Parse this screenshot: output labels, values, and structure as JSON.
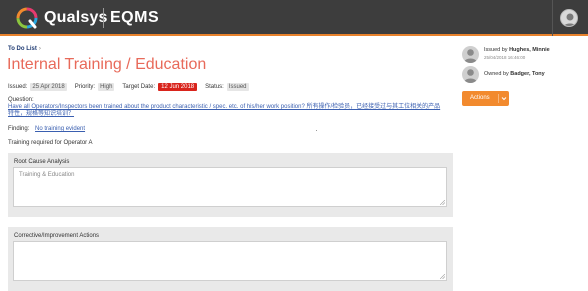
{
  "header": {
    "brand": "Qualsys",
    "product": "EQMS",
    "colors": {
      "bar": "#3d3d3d",
      "accent": "#e8822c"
    }
  },
  "breadcrumb": {
    "label": "To Do List",
    "arrow": "›"
  },
  "page": {
    "title": "Internal Training / Education"
  },
  "meta": {
    "issued_label": "Issued:",
    "issued_value": "25 Apr 2018",
    "priority_label": "Priority:",
    "priority_value": "High",
    "target_label": "Target Date:",
    "target_value": "12 Jun 2018",
    "status_label": "Status:",
    "status_value": "Issued",
    "target_color": "#d9241c"
  },
  "question": {
    "label": "Question:",
    "text": "Have all Operators/Inspectors been trained about the product characteristic / spec. etc. of his/her work position? 所有操作/检验员，已经接受过与其工位相关的产品特性，规格等知识培训？"
  },
  "finding": {
    "label": "Finding:",
    "value": "No training evident"
  },
  "training_note": "Training required for Operator A",
  "root_cause": {
    "label": "Root Cause Analysis",
    "placeholder": "Training & Education"
  },
  "corrective": {
    "label": "Corrective/Improvement Actions",
    "placeholder": ""
  },
  "issued_by": {
    "prefix": "Issued by",
    "name": "Hughes, Minnie",
    "date": "25/04/2018 16:46:00"
  },
  "owned_by": {
    "prefix": "Owned by",
    "name": "Badger, Tony"
  },
  "actions": {
    "label": "Actions",
    "color": "#f28a2e"
  },
  "icons": [
    "qualsys-logo-icon",
    "user-avatar-icon",
    "chevron-down-icon",
    "resize-grip-icon"
  ]
}
